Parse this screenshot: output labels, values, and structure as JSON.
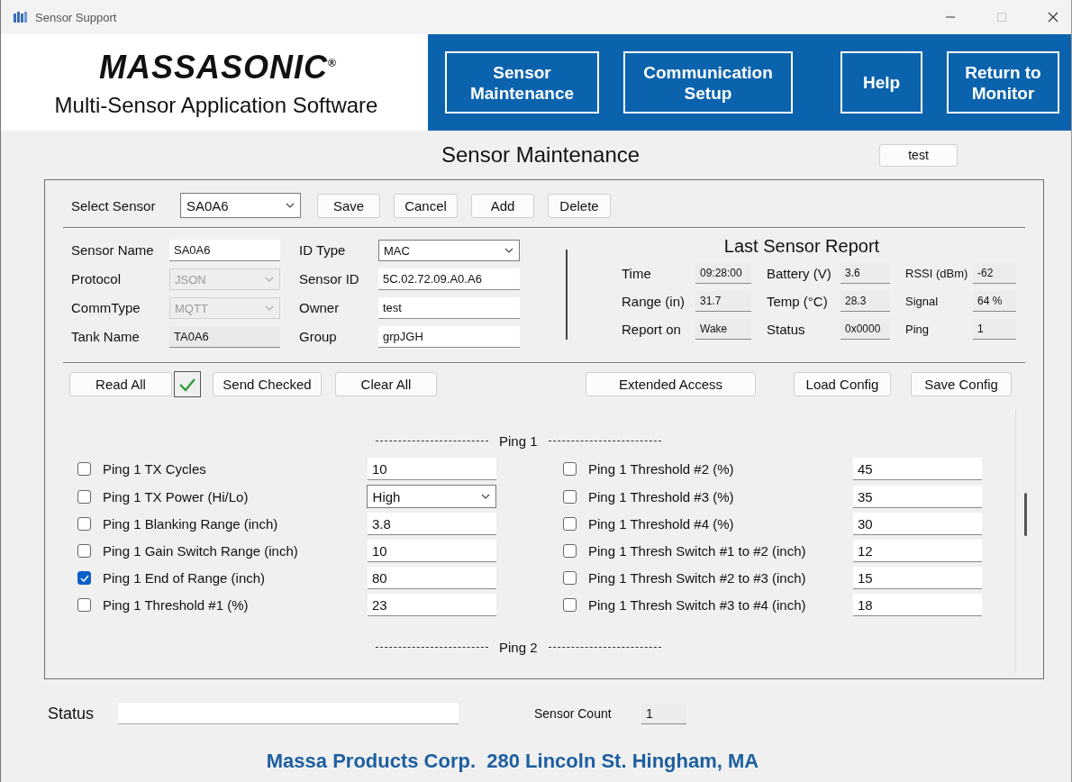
{
  "window": {
    "title": "Sensor Support",
    "maximize_disabled": true
  },
  "header": {
    "logo": "MASSASONIC$^{®}$",
    "subtitle": "Multi-Sensor Application Software",
    "nav_buttons": [
      "Sensor Maintenance",
      "Communication Setup",
      "Help",
      "Return to Monitor"
    ]
  },
  "page_title": "Sensor Maintenance",
  "user_button": "test",
  "select_sensor": {
    "label": "Select Sensor",
    "value": "SA0A6"
  },
  "actions": [
    "Save",
    "Cancel",
    "Add",
    "Delete"
  ],
  "sensor_fields": [
    {
      "label": "Sensor Name",
      "value": "SA0A6",
      "kind": "text",
      "disabled": false
    },
    {
      "label": "ID Type",
      "value": "MAC",
      "kind": "select",
      "disabled": false
    },
    {
      "label": "Protocol",
      "value": "JSON",
      "kind": "select",
      "disabled": true
    },
    {
      "label": "Sensor ID",
      "value": "5C.02.72.09.A0.A6",
      "kind": "text",
      "disabled": false
    },
    {
      "label": "CommType",
      "value": "MQTT",
      "kind": "select",
      "disabled": true
    },
    {
      "label": "Owner",
      "value": "test",
      "kind": "text",
      "disabled": false
    },
    {
      "label": "Tank Name",
      "value": "TA0A6",
      "kind": "readonly",
      "disabled": false
    },
    {
      "label": "Group",
      "value": "grpJGH",
      "kind": "text",
      "disabled": false
    }
  ],
  "last_report": {
    "title": "Last Sensor Report",
    "fields": [
      {
        "label": "Time",
        "value": "09:28:00"
      },
      {
        "label": "Battery (V)",
        "value": "3.6"
      },
      {
        "label": "RSSI (dBm)",
        "value": "-62"
      },
      {
        "label": "Range (in)",
        "value": "31.7"
      },
      {
        "label": "Temp (°C)",
        "value": "28.3"
      },
      {
        "label": "Signal",
        "value": "64 %"
      },
      {
        "label": "Report on",
        "value": "Wake"
      },
      {
        "label": "Status",
        "value": "0x0000"
      },
      {
        "label": "Ping",
        "value": "1"
      }
    ]
  },
  "toolbar_left": [
    {
      "kind": "button",
      "label": "Read All"
    },
    {
      "kind": "check"
    },
    {
      "kind": "button",
      "label": "Send Checked"
    },
    {
      "kind": "button",
      "label": "Clear All"
    }
  ],
  "toolbar_right": [
    "Extended Access",
    "Load Config",
    "Save Config"
  ],
  "sections": [
    {
      "title": "Ping 1",
      "rows": [
        {
          "label": "Ping 1 TX Cycles",
          "checked": false,
          "value": "10",
          "kind": "text"
        },
        {
          "label": "Ping 1 Threshold #2 (%)",
          "checked": false,
          "value": "45",
          "kind": "text"
        },
        {
          "label": "Ping 1 TX Power (Hi/Lo)",
          "checked": false,
          "value": "High",
          "kind": "select"
        },
        {
          "label": "Ping 1 Threshold #3 (%)",
          "checked": false,
          "value": "35",
          "kind": "text"
        },
        {
          "label": "Ping 1 Blanking Range (inch)",
          "checked": false,
          "value": "3.8",
          "kind": "text"
        },
        {
          "label": "Ping 1 Threshold #4 (%)",
          "checked": false,
          "value": "30",
          "kind": "text"
        },
        {
          "label": "Ping 1 Gain Switch Range (inch)",
          "checked": false,
          "value": "10",
          "kind": "text"
        },
        {
          "label": "Ping 1 Thresh Switch #1 to #2 (inch)",
          "checked": false,
          "value": "12",
          "kind": "text"
        },
        {
          "label": "Ping 1 End of Range (inch)",
          "checked": true,
          "value": "80",
          "kind": "text"
        },
        {
          "label": "Ping 1 Thresh Switch #2 to #3 (inch)",
          "checked": false,
          "value": "15",
          "kind": "text"
        },
        {
          "label": "Ping 1 Threshold #1 (%)",
          "checked": false,
          "value": "23",
          "kind": "text"
        },
        {
          "label": "Ping 1 Thresh Switch #3 to #4 (inch)",
          "checked": false,
          "value": "18",
          "kind": "text"
        }
      ]
    },
    {
      "title": "Ping 2"
    }
  ],
  "status": {
    "label": "Status",
    "count_label": "Sensor Count",
    "count": "1"
  },
  "footer": "Massa Products Corp.  280 Lincoln St. Hingham, MA"
}
